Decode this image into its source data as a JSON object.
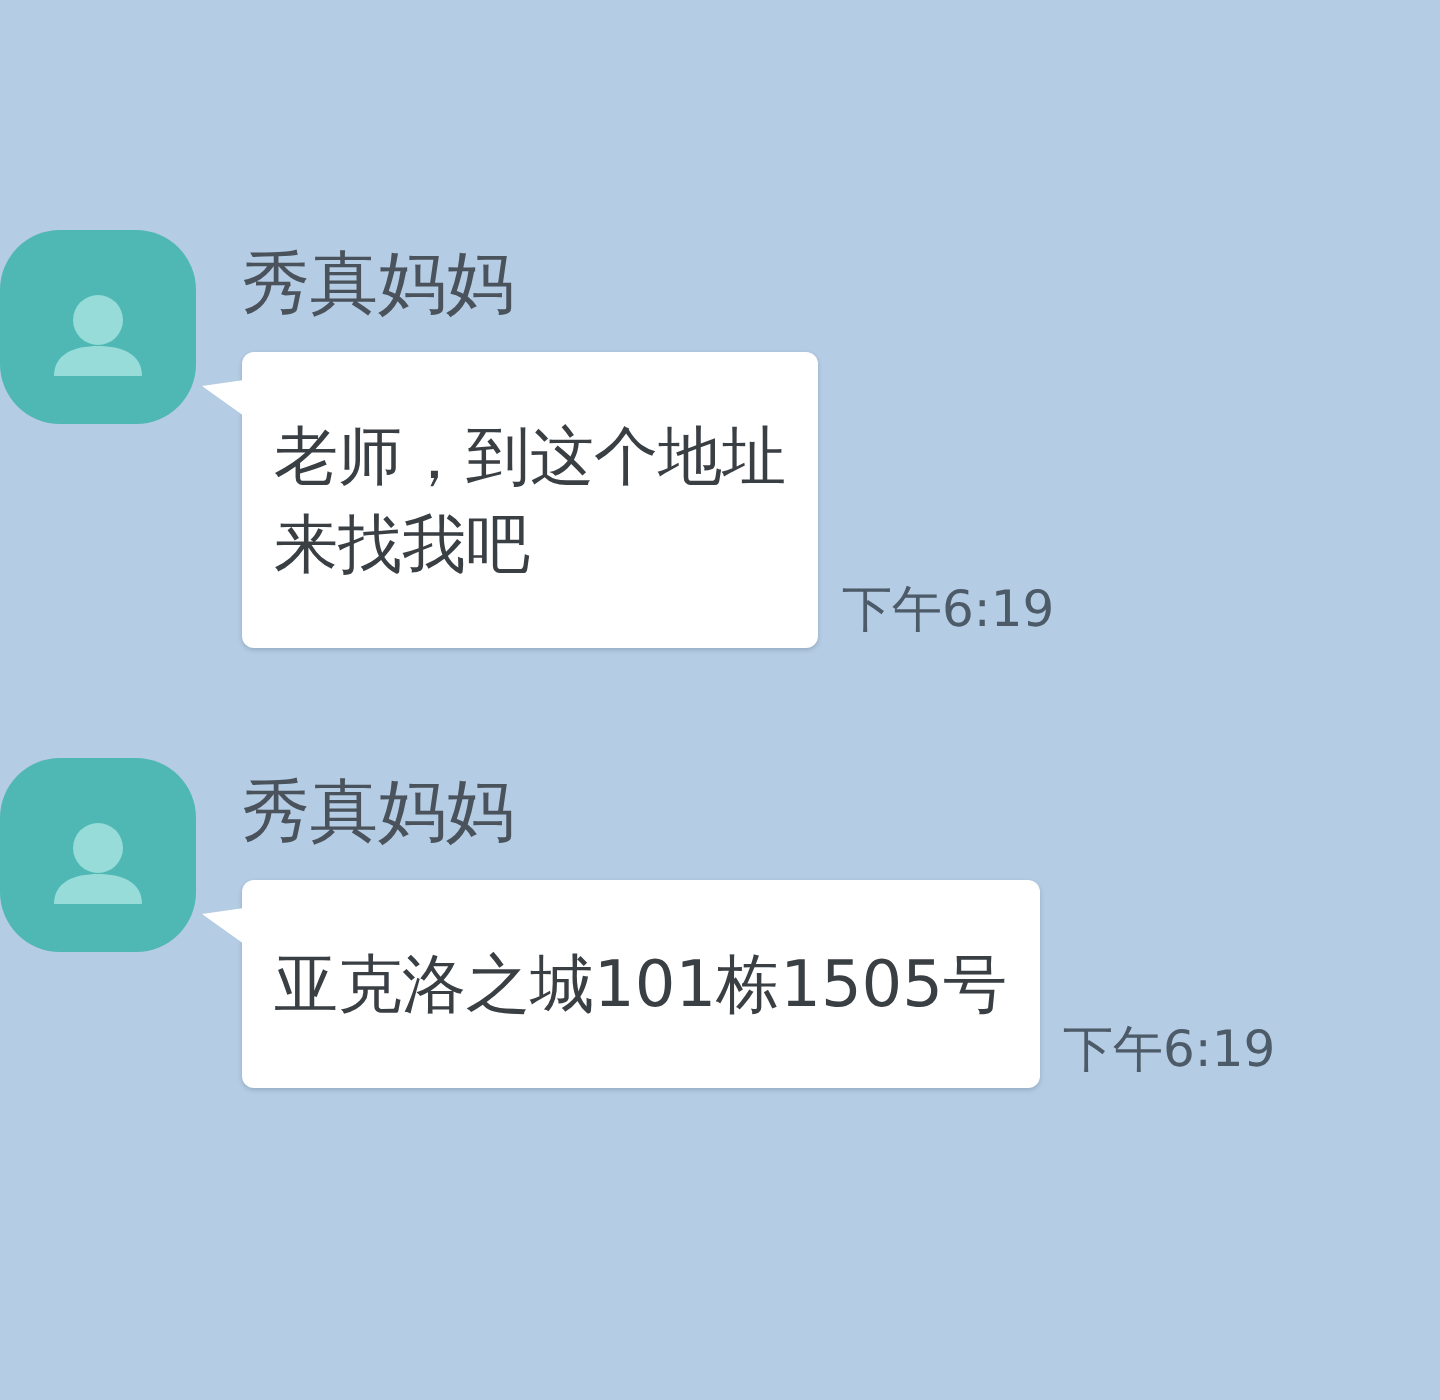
{
  "messages": [
    {
      "sender": "秀真妈妈",
      "lines": [
        "老师，到这个地址",
        "来找我吧"
      ],
      "time": "下午6:19"
    },
    {
      "sender": "秀真妈妈",
      "lines": [
        "亚克洛之城101栋1505号"
      ],
      "time": "下午6:19"
    }
  ]
}
